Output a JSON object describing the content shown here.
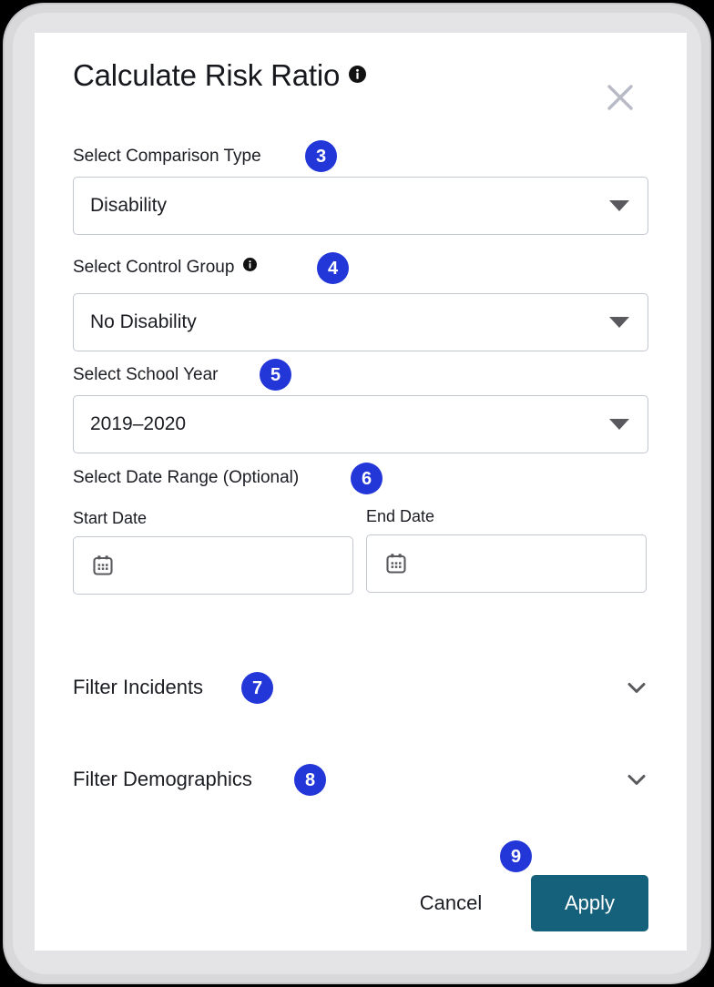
{
  "dialog": {
    "title": "Calculate Risk Ratio",
    "title_info_icon": "info-icon",
    "close_icon": "close-icon"
  },
  "fields": {
    "comparison_type": {
      "label": "Select Comparison Type",
      "badge": "3",
      "value": "Disability",
      "caret_icon": "chevron-down-icon"
    },
    "control_group": {
      "label": "Select Control Group",
      "info_icon": "info-icon",
      "badge": "4",
      "value": "No Disability",
      "caret_icon": "chevron-down-icon"
    },
    "school_year": {
      "label": "Select School Year",
      "badge": "5",
      "value": "2019–2020",
      "caret_icon": "chevron-down-icon"
    },
    "date_range": {
      "label": "Select Date Range (Optional)",
      "badge": "6",
      "start": {
        "label": "Start Date",
        "value": "",
        "icon": "calendar-icon"
      },
      "end": {
        "label": "End Date",
        "value": "",
        "icon": "calendar-icon"
      }
    }
  },
  "accordions": [
    {
      "title": "Filter Incidents",
      "badge": "7",
      "chevron_icon": "chevron-down-icon"
    },
    {
      "title": "Filter Demographics",
      "badge": "8",
      "chevron_icon": "chevron-down-icon"
    }
  ],
  "footer": {
    "cancel_label": "Cancel",
    "apply_label": "Apply",
    "apply_badge": "9"
  },
  "colors": {
    "badge_blue": "#2336d8",
    "apply_teal": "#15607a",
    "field_border": "#c3c7d2",
    "text": "#1b1d23",
    "close_gray": "#b8bac6",
    "icon_gray": "#5a5a5e",
    "frame_gray": "#d8d8da"
  }
}
